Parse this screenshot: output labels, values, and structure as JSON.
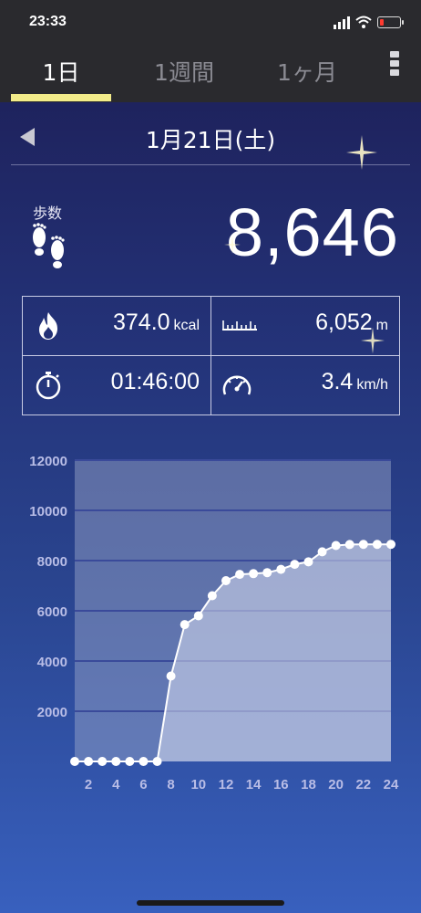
{
  "status_bar": {
    "time": "23:33"
  },
  "tabs": [
    {
      "label": "1日",
      "active": true
    },
    {
      "label": "1週間",
      "active": false
    },
    {
      "label": "1ヶ月",
      "active": false
    }
  ],
  "date": "1月21日(土)",
  "steps": {
    "label": "歩数",
    "value": "8,646"
  },
  "stats": {
    "calories": {
      "value": "374.0",
      "unit": "kcal"
    },
    "distance": {
      "value": "6,052",
      "unit": "m"
    },
    "duration": {
      "value": "01:46:00"
    },
    "speed": {
      "value": "3.4",
      "unit": "km/h"
    }
  },
  "colors": {
    "accent": "#f3ec8a",
    "tab_bar": "#2a2a2e"
  },
  "chart_data": {
    "type": "area",
    "title": "",
    "xlabel": "",
    "ylabel": "",
    "x": [
      1,
      2,
      3,
      4,
      5,
      6,
      7,
      8,
      9,
      10,
      11,
      12,
      13,
      14,
      15,
      16,
      17,
      18,
      19,
      20,
      21,
      22,
      23,
      24
    ],
    "x_ticks": [
      "2",
      "4",
      "6",
      "8",
      "10",
      "12",
      "14",
      "16",
      "18",
      "20",
      "22",
      "24"
    ],
    "y_ticks": [
      "2000",
      "4000",
      "6000",
      "8000",
      "10000",
      "12000"
    ],
    "ylim": [
      0,
      12000
    ],
    "xlim": [
      1,
      24
    ],
    "series": [
      {
        "values": [
          0,
          0,
          0,
          0,
          0,
          0,
          0,
          3400,
          5450,
          5800,
          6600,
          7200,
          7450,
          7480,
          7520,
          7650,
          7850,
          7950,
          8350,
          8600,
          8640,
          8646,
          8646,
          8646
        ]
      }
    ],
    "grid": true
  }
}
